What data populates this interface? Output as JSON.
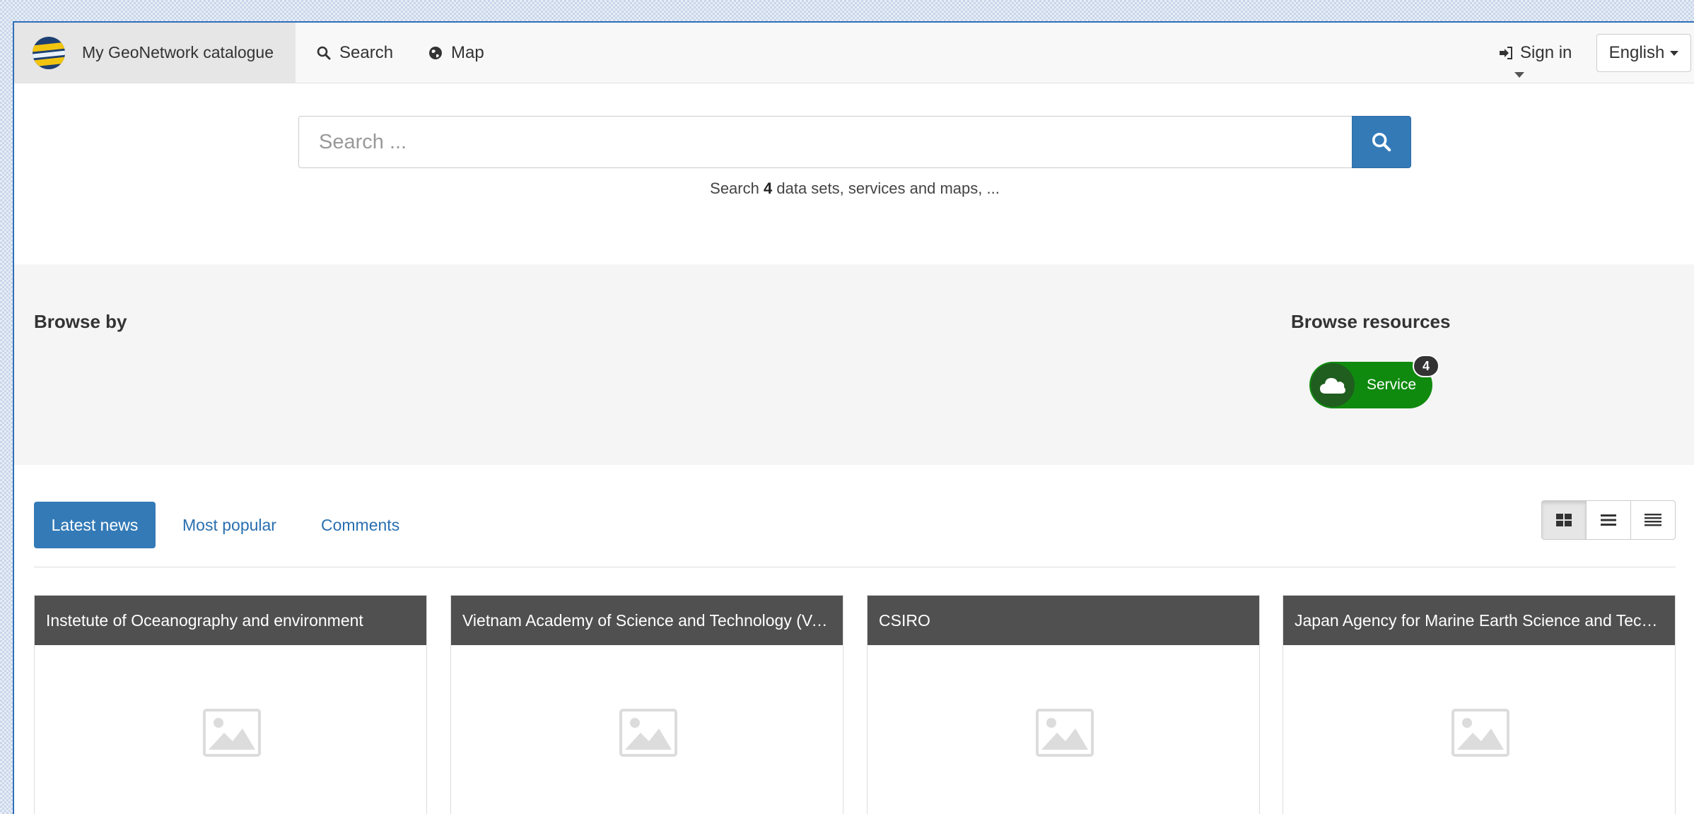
{
  "navbar": {
    "brand_label": "My GeoNetwork catalogue",
    "search_label": "Search",
    "map_label": "Map",
    "signin_label": "Sign in",
    "language_label": "English"
  },
  "search": {
    "placeholder": "Search ...",
    "hint_prefix": "Search",
    "hint_count": "4",
    "hint_suffix": "data sets, services and maps, ..."
  },
  "browse": {
    "browse_by_title": "Browse by",
    "browse_resources_title": "Browse resources",
    "resources": [
      {
        "label": "Service",
        "count": "4",
        "icon": "cloud-icon",
        "color": "#0f8a0f"
      }
    ]
  },
  "tabs": [
    {
      "label": "Latest news",
      "active": true
    },
    {
      "label": "Most popular",
      "active": false
    },
    {
      "label": "Comments",
      "active": false
    }
  ],
  "view_modes": [
    "grid-view-icon",
    "list-view-icon",
    "compact-list-view-icon"
  ],
  "cards": [
    {
      "title": "Instetute of Oceanography and environment"
    },
    {
      "title": "Vietnam Academy of Science and Technology (VAST)"
    },
    {
      "title": "CSIRO"
    },
    {
      "title": "Japan Agency for Marine Earth Science and Technology"
    }
  ],
  "colors": {
    "primary": "#337ab7",
    "service_green": "#0f8a0f",
    "card_header": "#505050"
  }
}
